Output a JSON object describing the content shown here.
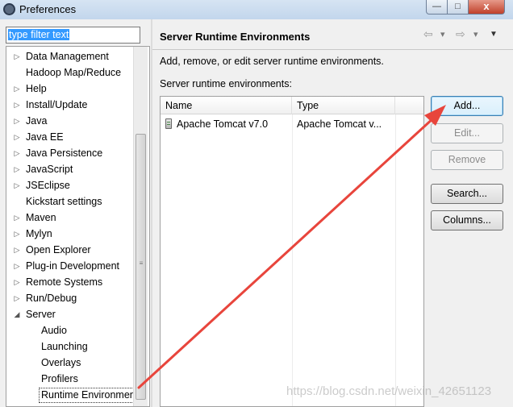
{
  "window": {
    "title": "Preferences",
    "min_glyph": "—",
    "max_glyph": "□",
    "close_glyph": "x"
  },
  "filter": {
    "value": "type filter text"
  },
  "tree": {
    "items": [
      {
        "label": "Data Management",
        "expander": "▷",
        "level": 0
      },
      {
        "label": "Hadoop Map/Reduce",
        "expander": "",
        "level": 0
      },
      {
        "label": "Help",
        "expander": "▷",
        "level": 0
      },
      {
        "label": "Install/Update",
        "expander": "▷",
        "level": 0
      },
      {
        "label": "Java",
        "expander": "▷",
        "level": 0
      },
      {
        "label": "Java EE",
        "expander": "▷",
        "level": 0
      },
      {
        "label": "Java Persistence",
        "expander": "▷",
        "level": 0
      },
      {
        "label": "JavaScript",
        "expander": "▷",
        "level": 0
      },
      {
        "label": "JSEclipse",
        "expander": "▷",
        "level": 0
      },
      {
        "label": "Kickstart settings",
        "expander": "",
        "level": 0
      },
      {
        "label": "Maven",
        "expander": "▷",
        "level": 0
      },
      {
        "label": "Mylyn",
        "expander": "▷",
        "level": 0
      },
      {
        "label": "Open Explorer",
        "expander": "▷",
        "level": 0
      },
      {
        "label": "Plug-in Development",
        "expander": "▷",
        "level": 0
      },
      {
        "label": "Remote Systems",
        "expander": "▷",
        "level": 0
      },
      {
        "label": "Run/Debug",
        "expander": "▷",
        "level": 0
      },
      {
        "label": "Server",
        "expander": "◢",
        "level": 0
      },
      {
        "label": "Audio",
        "expander": "",
        "level": 1
      },
      {
        "label": "Launching",
        "expander": "",
        "level": 1
      },
      {
        "label": "Overlays",
        "expander": "",
        "level": 1
      },
      {
        "label": "Profilers",
        "expander": "",
        "level": 1
      },
      {
        "label": "Runtime Environments",
        "expander": "",
        "level": 1,
        "selected": true
      }
    ]
  },
  "page": {
    "title": "Server Runtime Environments",
    "back_glyph": "⇦",
    "forward_glyph": "⇨",
    "dropdown_glyph": "▾",
    "menu_glyph": "▼",
    "description": "Add, remove, or edit server runtime environments.",
    "list_label": "Server runtime environments:"
  },
  "table": {
    "columns": [
      "Name",
      "Type"
    ],
    "rows": [
      {
        "name": "Apache Tomcat v7.0",
        "type": "Apache Tomcat v..."
      }
    ]
  },
  "buttons": {
    "add": "Add...",
    "edit": "Edit...",
    "remove": "Remove",
    "search": "Search...",
    "columns": "Columns..."
  },
  "watermark": "https://blog.csdn.net/weixin_42651123",
  "colors": {
    "selection": "#3399ff",
    "annotation_arrow": "#e8453c"
  }
}
